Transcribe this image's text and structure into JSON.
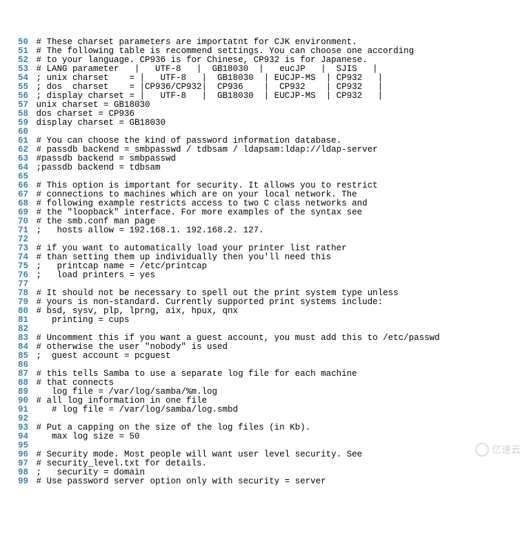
{
  "lines": [
    {
      "n": 50,
      "t": "# These charset parameters are importatnt for CJK environment."
    },
    {
      "n": 51,
      "t": "# The following table is recommend settings. You can choose one according"
    },
    {
      "n": 52,
      "t": "# to your language. CP936 is for Chinese, CP932 is for Japanese."
    },
    {
      "n": 53,
      "t": "# LANG parameter   |   UTF-8   |  GB18030  |   eucJP   |  SJIS   |"
    },
    {
      "n": 54,
      "t": "; unix charset    = |   UTF-8   |  GB18030  | EUCJP-MS  | CP932   |"
    },
    {
      "n": 55,
      "t": "; dos  charset    = |CP936/CP932|  CP936    |  CP932    | CP932   |"
    },
    {
      "n": 56,
      "t": "; display charset = |   UTF-8   |  GB18030  | EUCJP-MS  | CP932   |"
    },
    {
      "n": 57,
      "t": "unix charset = GB18030"
    },
    {
      "n": 58,
      "t": "dos charset = CP936"
    },
    {
      "n": 59,
      "t": "display charset = GB18030"
    },
    {
      "n": 60,
      "t": ""
    },
    {
      "n": 61,
      "t": "# You can choose the kind of password information database."
    },
    {
      "n": 62,
      "t": "# passdb backend = smbpasswd / tdbsam / ldapsam:ldap://ldap-server"
    },
    {
      "n": 63,
      "t": "#passdb backend = smbpasswd"
    },
    {
      "n": 64,
      "t": ";passdb backend = tdbsam"
    },
    {
      "n": 65,
      "t": ""
    },
    {
      "n": 66,
      "t": "# This option is important for security. It allows you to restrict"
    },
    {
      "n": 67,
      "t": "# connections to machines which are on your local network. The"
    },
    {
      "n": 68,
      "t": "# following example restricts access to two C class networks and"
    },
    {
      "n": 69,
      "t": "# the \"loopback\" interface. For more examples of the syntax see"
    },
    {
      "n": 70,
      "t": "# the smb.conf man page"
    },
    {
      "n": 71,
      "t": ";   hosts allow = 192.168.1. 192.168.2. 127."
    },
    {
      "n": 72,
      "t": ""
    },
    {
      "n": 73,
      "t": "# if you want to automatically load your printer list rather"
    },
    {
      "n": 74,
      "t": "# than setting them up individually then you'll need this"
    },
    {
      "n": 75,
      "t": ";   printcap name = /etc/printcap"
    },
    {
      "n": 76,
      "t": ";   load printers = yes"
    },
    {
      "n": 77,
      "t": ""
    },
    {
      "n": 78,
      "t": "# It should not be necessary to spell out the print system type unless"
    },
    {
      "n": 79,
      "t": "# yours is non-standard. Currently supported print systems include:"
    },
    {
      "n": 80,
      "t": "# bsd, sysv, plp, lprng, aix, hpux, qnx"
    },
    {
      "n": 81,
      "t": "   printing = cups"
    },
    {
      "n": 82,
      "t": ""
    },
    {
      "n": 83,
      "t": "# Uncomment this if you want a guest account, you must add this to /etc/passwd"
    },
    {
      "n": 84,
      "t": "# otherwise the user \"nobody\" is used"
    },
    {
      "n": 85,
      "t": ";  guest account = pcguest"
    },
    {
      "n": 86,
      "t": ""
    },
    {
      "n": 87,
      "t": "# this tells Samba to use a separate log file for each machine"
    },
    {
      "n": 88,
      "t": "# that connects"
    },
    {
      "n": 89,
      "t": "   log file = /var/log/samba/%m.log"
    },
    {
      "n": 90,
      "t": "# all log information in one file"
    },
    {
      "n": 91,
      "t": "   # log file = /var/log/samba/log.smbd"
    },
    {
      "n": 92,
      "t": ""
    },
    {
      "n": 93,
      "t": "# Put a capping on the size of the log files (in Kb)."
    },
    {
      "n": 94,
      "t": "   max log size = 50"
    },
    {
      "n": 95,
      "t": ""
    },
    {
      "n": 96,
      "t": "# Security mode. Most people will want user level security. See"
    },
    {
      "n": 97,
      "t": "# security_level.txt for details."
    },
    {
      "n": 98,
      "t": ";   security = domain"
    },
    {
      "n": 99,
      "t": "# Use password server option only with security = server"
    }
  ],
  "watermark": "亿速云"
}
